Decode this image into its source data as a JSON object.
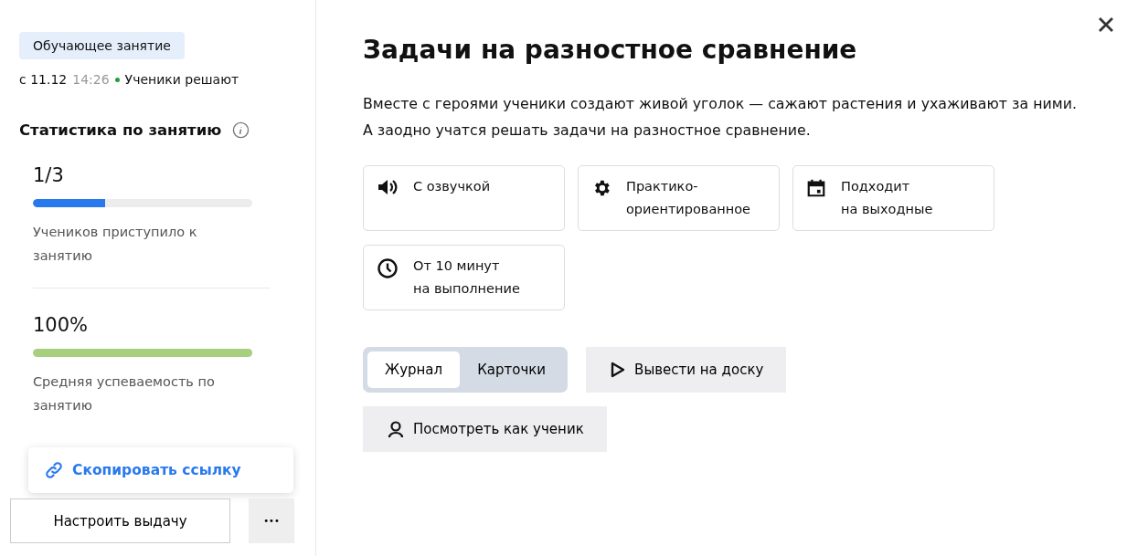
{
  "sidebar": {
    "badge": "Обучающее занятие",
    "date": "с 11.12",
    "time": "14:26",
    "status": {
      "text": "Ученики решают",
      "color": "#21a038"
    },
    "stats_title": "Статистика по занятию",
    "stats": [
      {
        "value": "1/3",
        "level": 0.33,
        "color": "#2979ee",
        "caption": "Учеников приступило к занятию"
      },
      {
        "value": "100%",
        "level": 1,
        "color": "#a8cf7e",
        "caption": "Средняя успеваемость по занятию"
      }
    ],
    "popup": {
      "item": "Скопировать ссылку"
    },
    "setup_button": "Настроить выдачу",
    "more_button": "•••"
  },
  "main": {
    "title": "Задачи на разностное сравнение",
    "description": "Вместе с героями ученики создают живой уголок — сажают растения и ухаживают за ними. А заодно учатся решать задачи на разностное сравнение.",
    "features": [
      {
        "kind": "sound",
        "lines": [
          "С озвучкой"
        ]
      },
      {
        "kind": "gear",
        "lines": [
          "Практико-",
          "ориентированное"
        ]
      },
      {
        "kind": "calendar",
        "lines": [
          "Подходит",
          "на выходные"
        ]
      },
      {
        "kind": "clock",
        "lines": [
          "От 10 минут",
          "на выполнение"
        ]
      }
    ],
    "tabs": [
      {
        "label": "Журнал",
        "selected": true
      },
      {
        "label": "Карточки",
        "selected": false
      }
    ],
    "buttons": [
      {
        "kind": "play",
        "label": "Вывести на доску"
      },
      {
        "kind": "person",
        "label": "Посмотреть как ученик"
      }
    ]
  }
}
